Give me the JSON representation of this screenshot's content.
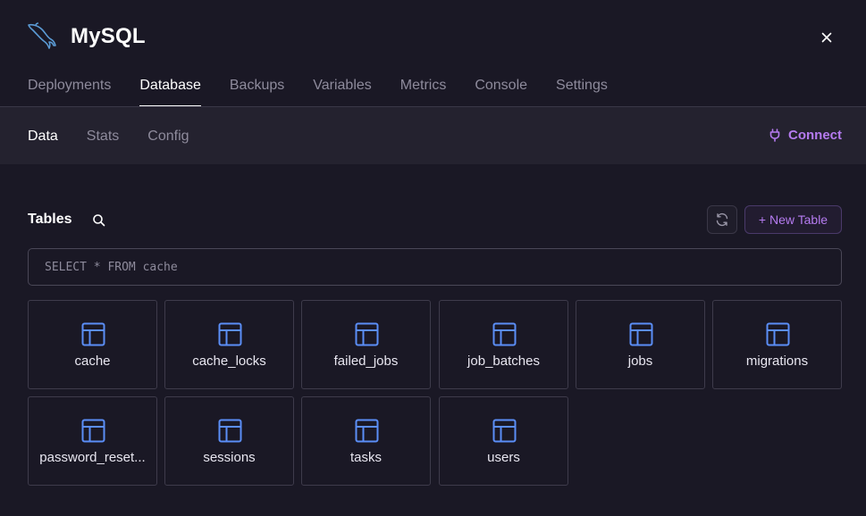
{
  "header": {
    "title": "MySQL",
    "logo_icon": "mysql-dolphin-icon",
    "close_icon": "close-icon"
  },
  "tabs": [
    {
      "label": "Deployments",
      "active": false
    },
    {
      "label": "Database",
      "active": true
    },
    {
      "label": "Backups",
      "active": false
    },
    {
      "label": "Variables",
      "active": false
    },
    {
      "label": "Metrics",
      "active": false
    },
    {
      "label": "Console",
      "active": false
    },
    {
      "label": "Settings",
      "active": false
    }
  ],
  "subtabs": [
    {
      "label": "Data",
      "active": true
    },
    {
      "label": "Stats",
      "active": false
    },
    {
      "label": "Config",
      "active": false
    }
  ],
  "connect": {
    "label": "Connect",
    "icon": "plug-icon"
  },
  "tables": {
    "title": "Tables",
    "search_icon": "search-icon",
    "refresh_icon": "refresh-icon",
    "new_table_label": "+ New Table",
    "query_placeholder": "SELECT * FROM cache",
    "items": [
      "cache",
      "cache_locks",
      "failed_jobs",
      "job_batches",
      "jobs",
      "migrations",
      "password_reset...",
      "sessions",
      "tasks",
      "users"
    ]
  },
  "colors": {
    "background": "#1a1825",
    "subnav_background": "#24222f",
    "accent": "#b57bf0",
    "table_icon": "#5b8ef7"
  }
}
